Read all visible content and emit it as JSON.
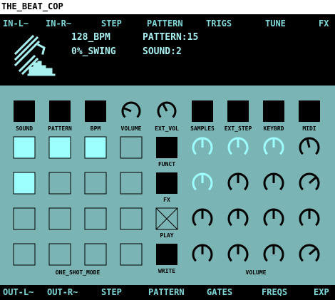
{
  "window": {
    "title": "THE_BEAT_COP"
  },
  "top_ports": [
    "IN-L~",
    "IN-R~",
    "STEP",
    "PATTERN",
    "TRIGS",
    "TUNE",
    "FX"
  ],
  "status": {
    "bpm": "128_BPM",
    "swing": "0%_SWING",
    "pattern": "PATTERN:15",
    "sound": "SOUND:2"
  },
  "top_controls": [
    {
      "label": "SOUND",
      "kind": "button"
    },
    {
      "label": "PATTERN",
      "kind": "button"
    },
    {
      "label": "BPM",
      "kind": "button"
    },
    {
      "label": "VOLUME",
      "kind": "knob",
      "level": 0.25
    },
    {
      "label": "EXT_VOL",
      "kind": "knob",
      "level": 0.4
    },
    {
      "label": "SAMPLES",
      "kind": "button"
    },
    {
      "label": "EXT_STEP",
      "kind": "button"
    },
    {
      "label": "KEYBRD",
      "kind": "button"
    },
    {
      "label": "MIDI",
      "kind": "button"
    }
  ],
  "step_grid": {
    "rows": [
      [
        true,
        true,
        true,
        false
      ],
      [
        true,
        false,
        false,
        false
      ],
      [
        false,
        false,
        false,
        false
      ],
      [
        false,
        false,
        false,
        false
      ]
    ],
    "label": "ONE_SHOT_MODE"
  },
  "function_buttons": [
    {
      "label": "FUNCT",
      "style": "filled"
    },
    {
      "label": "FX",
      "style": "filled"
    },
    {
      "label": "PLAY",
      "style": "crossed"
    },
    {
      "label": "WRITE",
      "style": "filled"
    }
  ],
  "volume_knobs": {
    "label": "VOLUME",
    "rows": [
      [
        {
          "level": 0.5,
          "highlighted": true
        },
        {
          "level": 0.5,
          "highlighted": true
        },
        {
          "level": 0.5,
          "highlighted": true
        },
        {
          "level": 0.45,
          "highlighted": false
        }
      ],
      [
        {
          "level": 0.5,
          "highlighted": true
        },
        {
          "level": 0.5,
          "highlighted": false
        },
        {
          "level": 0.5,
          "highlighted": false
        },
        {
          "level": 0.68,
          "highlighted": false
        }
      ],
      [
        {
          "level": 0.5,
          "highlighted": false
        },
        {
          "level": 0.5,
          "highlighted": false
        },
        {
          "level": 0.5,
          "highlighted": false
        },
        {
          "level": 0.5,
          "highlighted": false
        }
      ],
      [
        {
          "level": 0.5,
          "highlighted": false
        },
        {
          "level": 0.5,
          "highlighted": false
        },
        {
          "level": 0.5,
          "highlighted": false
        },
        {
          "level": 0.68,
          "highlighted": false
        }
      ]
    ]
  },
  "bottom_ports": [
    "OUT-L~",
    "OUT-R~",
    "STEP",
    "PATTERN",
    "GATES",
    "FREQS",
    "EXP"
  ],
  "colors": {
    "background": "#000000",
    "panel": "#7bb4b4",
    "text": "#7fd9d9",
    "highlight": "#9effff",
    "titlebar": "#ffffff"
  },
  "icons": {
    "logo": "beat-cop-logo-icon"
  }
}
